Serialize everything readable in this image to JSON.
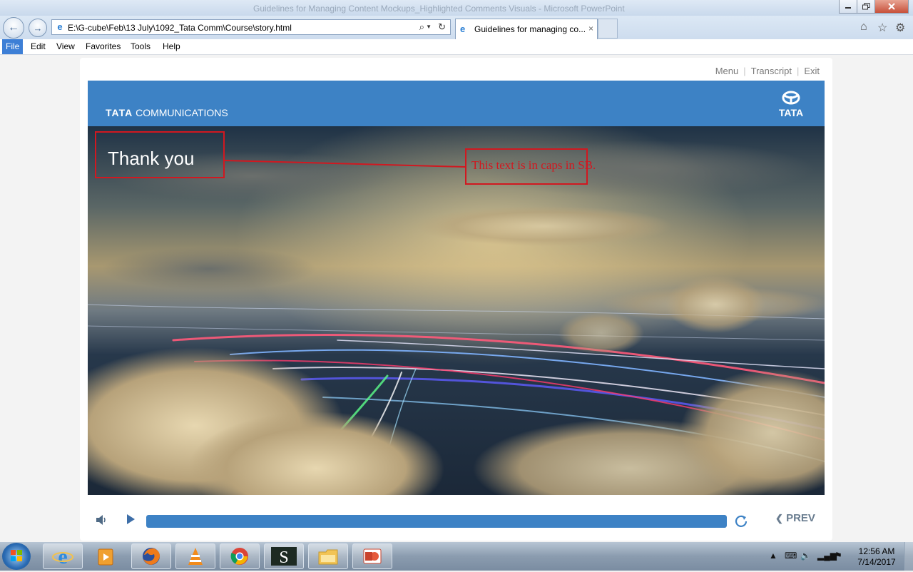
{
  "window": {
    "title": "Guidelines for Managing Content Mockups_Highlighted Comments Visuals - Microsoft PowerPoint",
    "min_icon": "minimize-icon",
    "max_icon": "maximize-icon",
    "close_icon": "close-icon"
  },
  "browser": {
    "address": "E:\\G-cube\\Feb\\13 July\\1092_Tata Comm\\Course\\story.html",
    "tab_title": "Guidelines for managing co...",
    "tab_close": "×"
  },
  "menu": [
    "File",
    "Edit",
    "View",
    "Favorites",
    "Tools",
    "Help"
  ],
  "player": {
    "top_links": [
      "Menu",
      "Transcript",
      "Exit"
    ],
    "brand_bold": "TATA",
    "brand_rest": "COMMUNICATIONS",
    "logo_text": "TATA",
    "slide_title": "Thank you",
    "annotation": "This text is in caps in SB.",
    "prev_label": "PREV",
    "progress": 1.0,
    "accent_color": "#3d82c5",
    "annotation_color": "#d11820"
  },
  "taskbar": {
    "apps": [
      "internet-explorer-icon",
      "media-player-icon",
      "firefox-icon",
      "vlc-icon",
      "chrome-icon",
      "s-app-icon",
      "file-explorer-icon",
      "powerpoint-icon"
    ],
    "time": "12:56 AM",
    "date": "7/14/2017"
  }
}
